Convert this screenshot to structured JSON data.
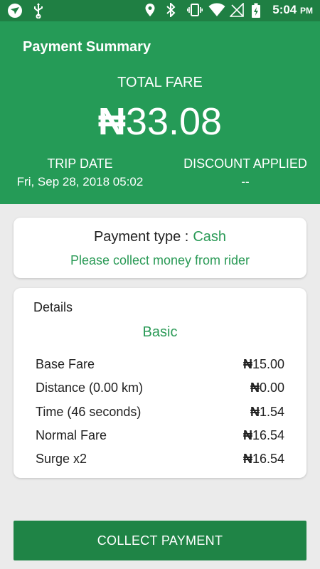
{
  "status_bar": {
    "time": "5:04",
    "ampm": "PM",
    "icons": [
      "app-logo-icon",
      "usb-icon",
      "location-icon",
      "bluetooth-icon",
      "vibrate-icon",
      "wifi-icon",
      "no-signal-icon",
      "battery-charging-icon"
    ]
  },
  "header": {
    "title": "Payment Summary",
    "total_fare_label": "TOTAL FARE",
    "total_fare_currency": "₦",
    "total_fare_amount": "33.08",
    "trip_date_label": "TRIP DATE",
    "trip_date_value": "Fri, Sep 28, 2018 05:02",
    "discount_label": "DISCOUNT APPLIED",
    "discount_value": "--"
  },
  "payment": {
    "type_label": "Payment type :",
    "type_value": "Cash",
    "note": "Please collect money from rider"
  },
  "details": {
    "title": "Details",
    "package": "Basic",
    "rows": [
      {
        "label": "Base Fare",
        "currency": "₦",
        "amount": "15.00"
      },
      {
        "label": "Distance (0.00 km)",
        "currency": "₦",
        "amount": "0.00"
      },
      {
        "label": "Time (46 seconds)",
        "currency": "₦",
        "amount": "1.54"
      },
      {
        "label": "Normal Fare",
        "currency": "₦",
        "amount": "16.54"
      },
      {
        "label": "Surge x2",
        "currency": "₦",
        "amount": "16.54"
      }
    ]
  },
  "actions": {
    "collect_label": "COLLECT PAYMENT"
  },
  "colors": {
    "header_green": "#259b57",
    "statusbar_green": "#1f7f43",
    "accent_green": "#2a9a56",
    "button_green": "#1f8446"
  }
}
